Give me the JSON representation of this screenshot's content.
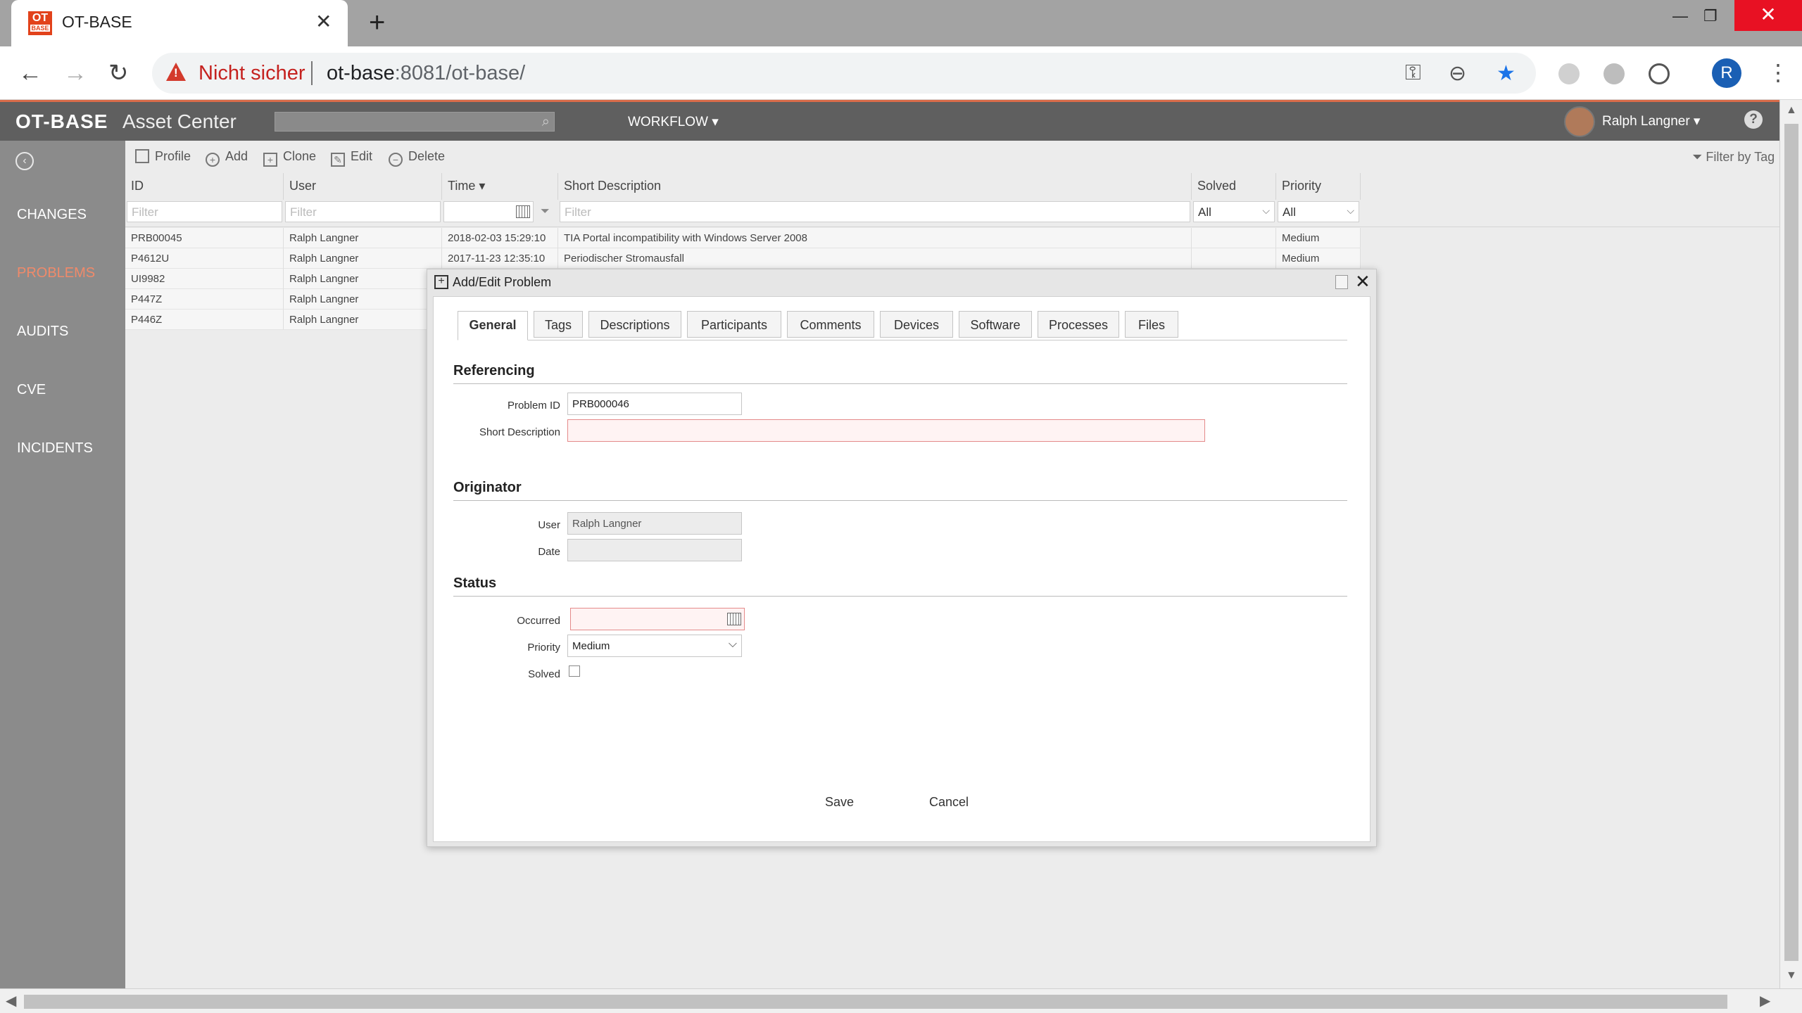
{
  "browser": {
    "tab_title": "OT-BASE",
    "favicon_top": "OT",
    "favicon_sub": "BASE",
    "close_glyph": "✕",
    "new_tab_glyph": "+",
    "security_label": "Nicht sicher",
    "url_host": "ot-base",
    "url_rest": ":8081/ot-base/",
    "profile_initial": "R",
    "accent_color": "#e2421b"
  },
  "app": {
    "logo": "OT-BASE",
    "name": "Asset Center",
    "workflow_label": "WORKFLOW ▾",
    "user_label": "Ralph Langner ▾",
    "help_glyph": "?"
  },
  "sidebar": {
    "items": [
      {
        "label": "CHANGES",
        "active": false
      },
      {
        "label": "PROBLEMS",
        "active": true
      },
      {
        "label": "AUDITS",
        "active": false
      },
      {
        "label": "CVE",
        "active": false
      },
      {
        "label": "INCIDENTS",
        "active": false
      }
    ]
  },
  "list_toolbar": {
    "profile": "Profile",
    "add": "Add",
    "clone": "Clone",
    "edit": "Edit",
    "delete": "Delete",
    "filter_by_tag": "Filter by Tag"
  },
  "grid": {
    "columns": {
      "id": "ID",
      "user": "User",
      "time": "Time ▾",
      "short_description": "Short Description",
      "solved": "Solved",
      "priority": "Priority"
    },
    "filter_placeholder": "Filter",
    "solved_filter": "All",
    "priority_filter": "All",
    "rows": [
      {
        "id": "PRB00045",
        "user": "Ralph Langner",
        "time": "2018-02-03 15:29:10",
        "desc": "TIA Portal incompatibility with Windows Server 2008",
        "solved": "",
        "priority": "Medium"
      },
      {
        "id": "P4612U",
        "user": "Ralph Langner",
        "time": "2017-11-23 12:35:10",
        "desc": "Periodischer Stromausfall",
        "solved": "",
        "priority": "Medium"
      },
      {
        "id": "UI9982",
        "user": "Ralph Langner",
        "time": "",
        "desc": "",
        "solved": "",
        "priority": ""
      },
      {
        "id": "P447Z",
        "user": "Ralph Langner",
        "time": "",
        "desc": "",
        "solved": "",
        "priority": ""
      },
      {
        "id": "P446Z",
        "user": "Ralph Langner",
        "time": "",
        "desc": "",
        "solved": "",
        "priority": ""
      }
    ]
  },
  "dialog": {
    "title": "Add/Edit Problem",
    "tabs": [
      "General",
      "Tags",
      "Descriptions",
      "Participants",
      "Comments",
      "Devices",
      "Software",
      "Processes",
      "Files"
    ],
    "sections": {
      "referencing": "Referencing",
      "originator": "Originator",
      "status": "Status"
    },
    "fields": {
      "problem_id_label": "Problem ID",
      "problem_id_value": "PRB000046",
      "short_desc_label": "Short Description",
      "short_desc_value": "",
      "user_label": "User",
      "user_value": "Ralph Langner",
      "date_label": "Date",
      "date_value": "",
      "occurred_label": "Occurred",
      "occurred_value": "",
      "priority_label": "Priority",
      "priority_value": "Medium",
      "solved_label": "Solved"
    },
    "save": "Save",
    "cancel": "Cancel"
  }
}
